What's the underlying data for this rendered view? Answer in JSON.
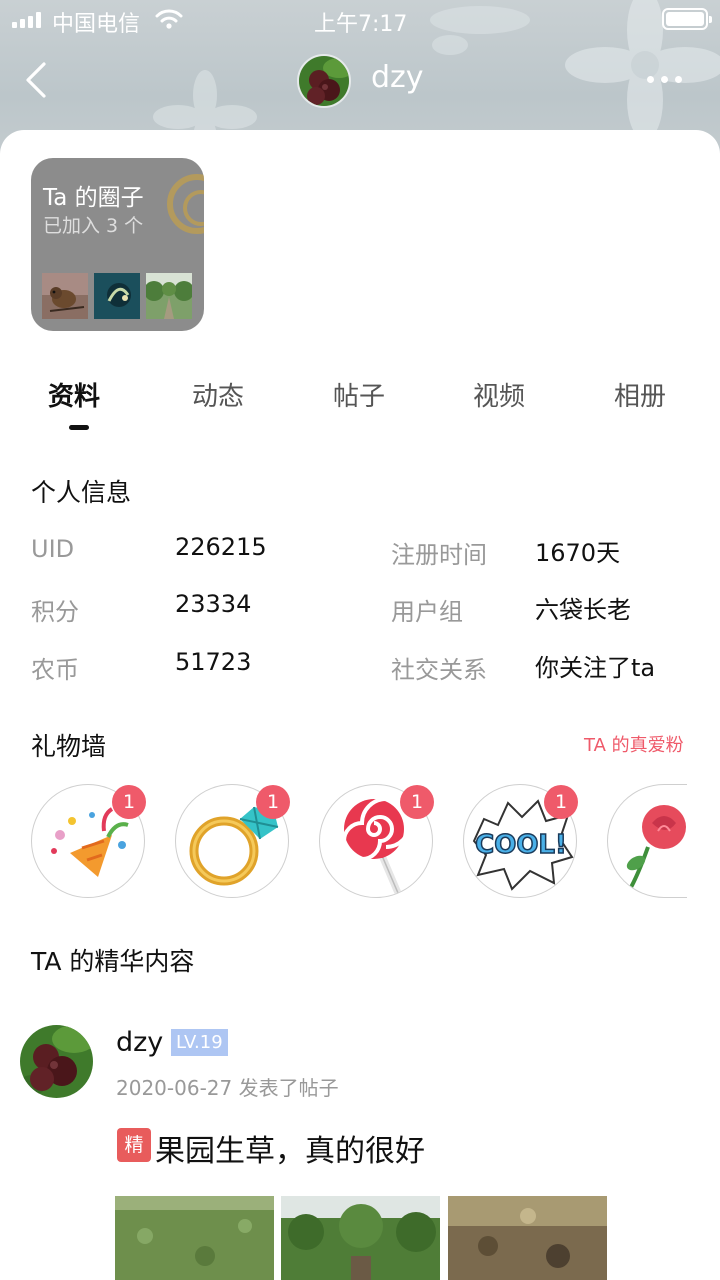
{
  "status_bar": {
    "carrier": "中国电信",
    "time": "上午7:17"
  },
  "nav": {
    "username": "dzy",
    "back_icon": "chevron-left-icon",
    "more_icon": "more-dots-icon"
  },
  "circle_card": {
    "title": "Ta 的圈子",
    "subtitle": "已加入 3 个"
  },
  "tabs": [
    {
      "label": "资料",
      "active": true
    },
    {
      "label": "动态",
      "active": false
    },
    {
      "label": "帖子",
      "active": false
    },
    {
      "label": "视频",
      "active": false
    },
    {
      "label": "相册",
      "active": false
    }
  ],
  "personal_info": {
    "title": "个人信息",
    "rows": [
      {
        "label": "UID",
        "value": "226215"
      },
      {
        "label": "注册时间",
        "value": "1670天"
      },
      {
        "label": "积分",
        "value": "23334"
      },
      {
        "label": "用户组",
        "value": "六袋长老"
      },
      {
        "label": "农币",
        "value": "51723"
      },
      {
        "label": "社交关系",
        "value": "你关注了ta"
      }
    ]
  },
  "gift_wall": {
    "title": "礼物墙",
    "fans_link": "TA 的真爱粉",
    "gifts": [
      {
        "name": "party-popper",
        "count": "1"
      },
      {
        "name": "diamond-ring",
        "count": "1"
      },
      {
        "name": "lollipop",
        "count": "1"
      },
      {
        "name": "cool-sticker",
        "count": "1",
        "text": "COOL!"
      },
      {
        "name": "rose",
        "count": ""
      }
    ]
  },
  "featured": {
    "title": "TA 的精华内容",
    "post": {
      "author": "dzy",
      "level": "LV.19",
      "meta": "2020-06-27 发表了帖子",
      "tag": "精",
      "title": "果园生草，真的很好"
    }
  },
  "colors": {
    "accent_red": "#ef5a6a",
    "level_blue": "#aec6f3"
  }
}
